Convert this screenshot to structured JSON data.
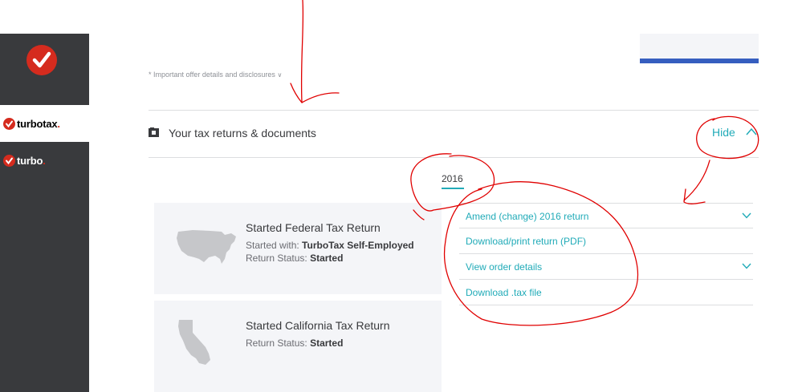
{
  "sidebar": {
    "brand_primary": "turbotax",
    "brand_primary_dot": ".",
    "brand_secondary": "turbo",
    "brand_secondary_dot": "."
  },
  "disclosure": {
    "text": "* Important offer details and disclosures",
    "chevron": "∨"
  },
  "section": {
    "title": "Your tax returns & documents",
    "hide_label": "Hide"
  },
  "year_tab": "2016",
  "returns": [
    {
      "title": "Started Federal Tax Return",
      "started_with_label": "Started with:",
      "started_with_value": "TurboTax Self-Employed",
      "status_label": "Return Status:",
      "status_value": "Started"
    },
    {
      "title": "Started California Tax Return",
      "status_label": "Return Status:",
      "status_value": "Started"
    }
  ],
  "actions": [
    {
      "label": "Amend (change) 2016 return",
      "has_chevron": true
    },
    {
      "label": "Download/print return (PDF)",
      "has_chevron": false
    },
    {
      "label": "View order details",
      "has_chevron": true
    },
    {
      "label": "Download .tax file",
      "has_chevron": false
    }
  ],
  "colors": {
    "accent": "#21abb8",
    "brand_red": "#d52b1e",
    "sidebar_dark": "#393a3d",
    "annotation_red": "#e00000",
    "top_bar_blue": "#365ebf"
  }
}
